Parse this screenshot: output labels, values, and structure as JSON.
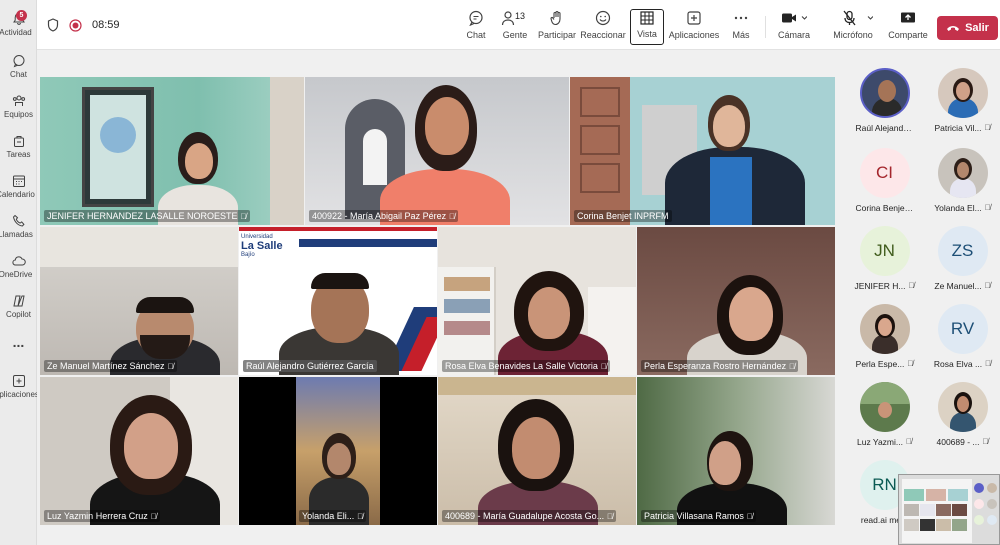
{
  "rail": {
    "items": [
      {
        "label": "Actividad",
        "icon": "bell-icon",
        "badge": "5"
      },
      {
        "label": "Chat",
        "icon": "chat-icon"
      },
      {
        "label": "Equipos",
        "icon": "teams-icon"
      },
      {
        "label": "Tareas",
        "icon": "tasks-icon"
      },
      {
        "label": "Calendario",
        "icon": "calendar-icon"
      },
      {
        "label": "Llamadas",
        "icon": "phone-icon"
      },
      {
        "label": "OneDrive",
        "icon": "cloud-icon"
      },
      {
        "label": "Copilot",
        "icon": "copilot-icon"
      },
      {
        "label": "...",
        "icon": "more-icon"
      },
      {
        "label": "Aplicaciones",
        "icon": "apps-add-icon"
      }
    ]
  },
  "topbar": {
    "timer": "08:59",
    "people_count": "13",
    "tools": [
      {
        "label": "Chat",
        "icon": "chat-icon"
      },
      {
        "label": "Gente",
        "icon": "people-icon"
      },
      {
        "label": "Participar",
        "icon": "raise-hand-icon"
      },
      {
        "label": "Reaccionar",
        "icon": "smile-icon"
      },
      {
        "label": "Vista",
        "icon": "grid-view-icon"
      },
      {
        "label": "Aplicaciones",
        "icon": "plus-square-icon"
      },
      {
        "label": "Más",
        "icon": "more-icon"
      },
      {
        "label": "Cámara",
        "icon": "camera-icon"
      },
      {
        "label": "Micrófono",
        "icon": "mic-off-icon"
      },
      {
        "label": "Comparte",
        "icon": "share-icon"
      }
    ],
    "leave_label": "Salir",
    "accent": "#c4314b"
  },
  "tiles": [
    {
      "name": "JENIFER HERNANDEZ LASALLE NOROESTE"
    },
    {
      "name": "400922 - María Abigail Paz Pérez"
    },
    {
      "name": "Corina Benjet INPRFM"
    },
    {
      "name": "Ze Manuel Martínez Sánchez"
    },
    {
      "name": "Raúl Alejandro Gutiérrez García",
      "logo_line1": "Universidad",
      "logo_line2": "La Salle",
      "logo_line3": "Bajío"
    },
    {
      "name": "Rosa Elva Benavides La Salle Victoria"
    },
    {
      "name": "Perla Esperanza Rostro Hernández"
    },
    {
      "name": "Luz Yazmin Herrera Cruz"
    },
    {
      "name": "Yolanda Eli..."
    },
    {
      "name": "400689 - María Guadalupe Acosta Go..."
    },
    {
      "name": "Patricia Villasana  Ramos"
    }
  ],
  "roster": [
    {
      "name": "Raúl Alejandro...",
      "initials": ""
    },
    {
      "name": "Patricia Vil...",
      "initials": ""
    },
    {
      "name": "Corina Benjet I...",
      "initials": "CI"
    },
    {
      "name": "Yolanda El...",
      "initials": ""
    },
    {
      "name": "JENIFER H...",
      "initials": "JN"
    },
    {
      "name": "Ze Manuel...",
      "initials": "ZS"
    },
    {
      "name": "Perla Espe...",
      "initials": ""
    },
    {
      "name": "Rosa Elva ...",
      "initials": "RV"
    },
    {
      "name": "Luz Yazmi...",
      "initials": ""
    },
    {
      "name": "400689 - ...",
      "initials": ""
    },
    {
      "name": "read.ai me...",
      "initials": "RN"
    }
  ]
}
